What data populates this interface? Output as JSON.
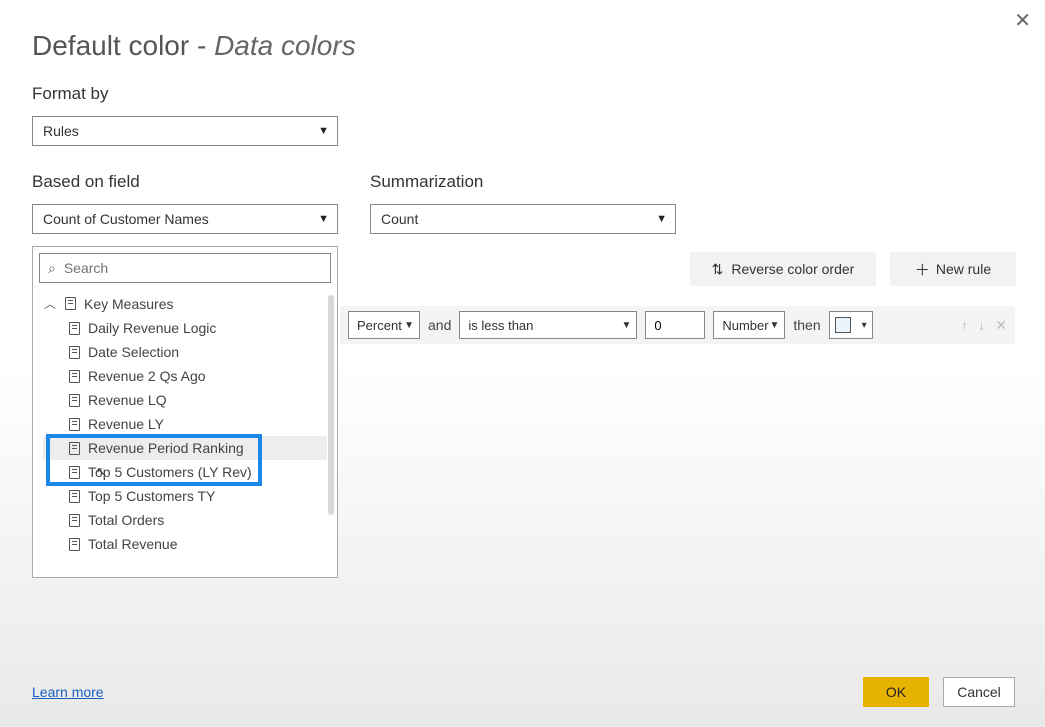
{
  "title_main": "Default color",
  "title_sub": "Data colors",
  "labels": {
    "format_by": "Format by",
    "based_on": "Based on field",
    "summarization": "Summarization"
  },
  "selects": {
    "format_by_value": "Rules",
    "based_on_value": "Count of Customer Names",
    "summarization_value": "Count"
  },
  "search_placeholder": "Search",
  "group_name": "Key Measures",
  "fields": [
    "Daily Revenue Logic",
    "Date Selection",
    "Revenue 2 Qs Ago",
    "Revenue LQ",
    "Revenue LY",
    "Revenue Period Ranking",
    "Top 5 Customers (LY Rev)",
    "Top 5 Customers TY",
    "Total Orders",
    "Total Revenue"
  ],
  "buttons": {
    "reverse": "Reverse color order",
    "newrule": "New rule",
    "ok": "OK",
    "cancel": "Cancel",
    "learn": "Learn more"
  },
  "rule": {
    "type1": "Percent",
    "and": "and",
    "op": "is less than",
    "value": "0",
    "type2": "Number",
    "then": "then"
  }
}
